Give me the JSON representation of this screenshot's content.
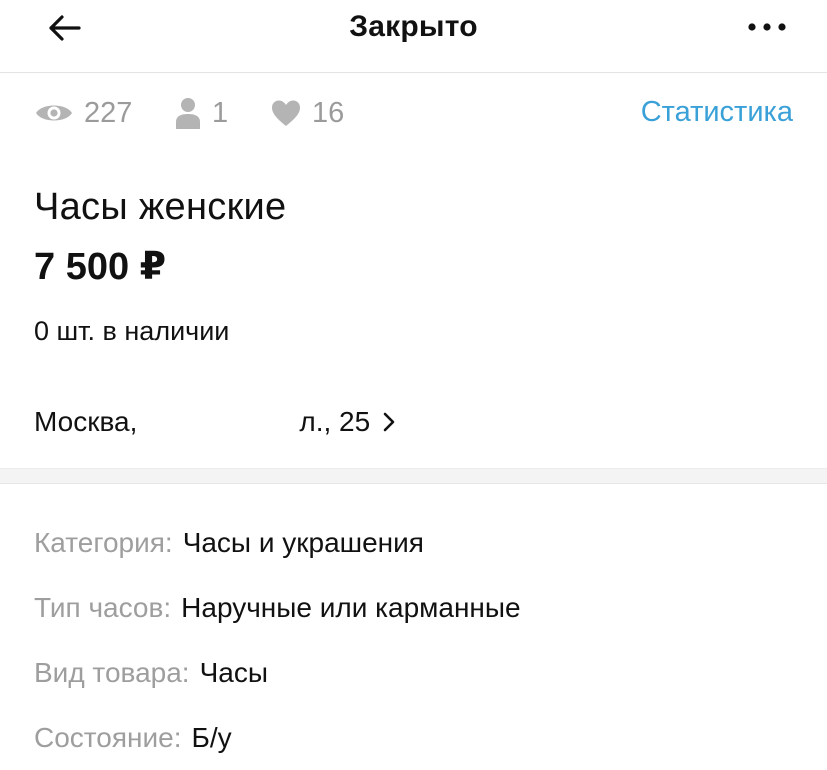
{
  "header": {
    "title": "Закрыто",
    "back_icon": "arrow-left-icon",
    "more_icon": "more-horizontal-icon"
  },
  "stats": {
    "views": "227",
    "contacts": "1",
    "favorites": "16",
    "link_label": "Статистика",
    "link_color": "#3aa0d8"
  },
  "listing": {
    "title": "Часы женские",
    "price": "7 500 ₽",
    "stock": "0 шт. в наличии",
    "address_start": "Москва,",
    "address_end": "л., 25"
  },
  "properties": [
    {
      "label": "Категория:",
      "value": "Часы и украшения"
    },
    {
      "label": "Тип часов:",
      "value": "Наручные или карманные"
    },
    {
      "label": "Вид товара:",
      "value": "Часы"
    },
    {
      "label": "Состояние:",
      "value": "Б/у"
    }
  ]
}
